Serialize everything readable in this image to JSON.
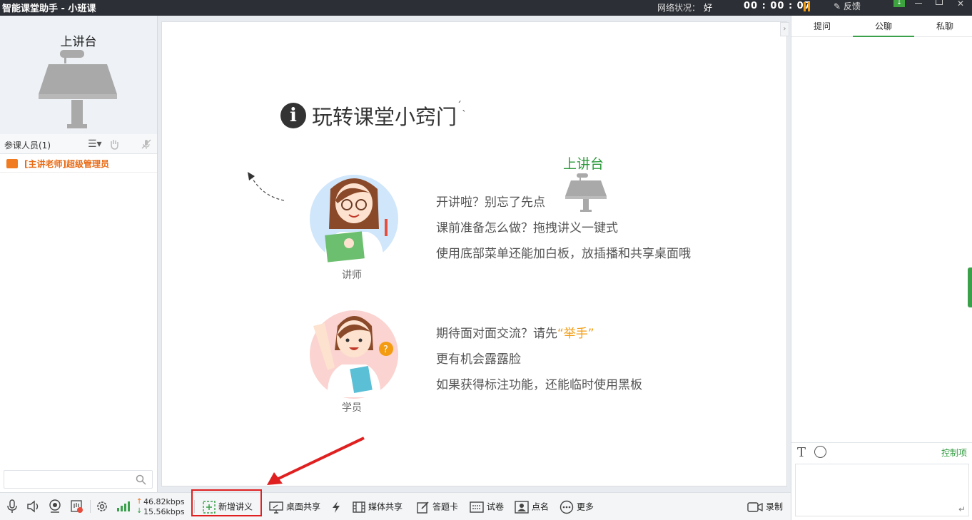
{
  "window": {
    "title": "智能课堂助手 - 小班课",
    "network_label": "网络状况：",
    "network_value": "好",
    "timer": "00 : 00 : 07",
    "feedback": "反馈"
  },
  "left": {
    "podium_label": "上讲台",
    "attendees_label": "参课人员(1)",
    "members": [
      {
        "label": "[主讲老师]超级管理员"
      }
    ],
    "search_placeholder": ""
  },
  "board": {
    "heading": "玩转课堂小窍门",
    "teacher_role": "讲师",
    "student_role": "学员",
    "podium_label": "上讲台",
    "teacher_tips": [
      "开讲啦？别忘了先点",
      "课前准备怎么做？拖拽讲义一键式",
      "使用底部菜单还能加白板，放插播和共享桌面哦"
    ],
    "student_tip_prefix": "期待面对面交流？请先",
    "student_tip_highlight": "“举手”",
    "student_tips": [
      "更有机会露露脸",
      "如果获得标注功能，还能临时使用黑板"
    ]
  },
  "right": {
    "tabs": [
      {
        "label": "提问"
      },
      {
        "label": "公聊"
      },
      {
        "label": "私聊"
      }
    ],
    "active_tab": "公聊",
    "control_label": "控制项",
    "text_tool": "T",
    "input_value": ""
  },
  "toolbar": {
    "upload_speed": "46.82kbps",
    "download_speed": "15.56kbps",
    "new_lecture": "新增讲义",
    "desktop_share": "桌面共享",
    "media_share": "媒体共享",
    "answer_card": "答题卡",
    "exam": "试卷",
    "roll_call": "点名",
    "more": "更多",
    "record": "录制"
  },
  "colors": {
    "accent_green": "#3aa04a",
    "highlight_orange": "#f39c12",
    "callout_red": "#e02020",
    "titlebar": "#2c2f35"
  }
}
